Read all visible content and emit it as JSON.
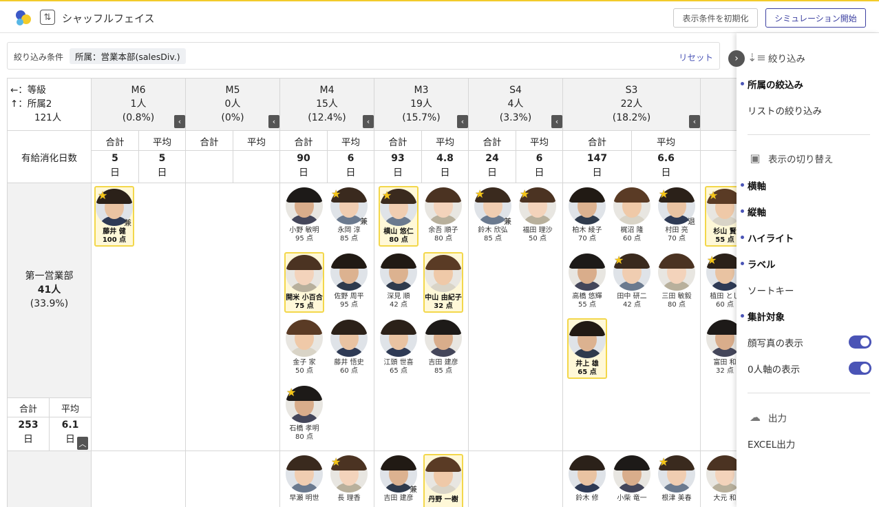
{
  "app": {
    "title": "シャッフルフェイス",
    "reset_view_label": "表示条件を初期化",
    "simulate_label": "シミュレーション開始"
  },
  "filter": {
    "label": "絞り込み条件",
    "chip": "所属：営業本部(salesDiv.)",
    "reset": "リセット"
  },
  "corner": {
    "x_axis": "←：等級",
    "y_axis": "↑：所属2",
    "total": "121人"
  },
  "metric": {
    "label": "有給消化日数",
    "sum_label": "合計",
    "avg_label": "平均"
  },
  "grades": [
    {
      "name": "M6",
      "count": "1人",
      "pct": "(0.8%)",
      "sum": "5",
      "avg": "5",
      "unit": "日"
    },
    {
      "name": "M5",
      "count": "0人",
      "pct": "(0%)",
      "sum": "",
      "avg": "",
      "unit": ""
    },
    {
      "name": "M4",
      "count": "15人",
      "pct": "(12.4%)",
      "sum": "90",
      "avg": "6",
      "unit": "日"
    },
    {
      "name": "M3",
      "count": "19人",
      "pct": "(15.7%)",
      "sum": "93",
      "avg": "4.8",
      "unit": "日"
    },
    {
      "name": "S4",
      "count": "4人",
      "pct": "(3.3%)",
      "sum": "24",
      "avg": "6",
      "unit": "日"
    },
    {
      "name": "S3",
      "count": "22人",
      "pct": "(18.2%)",
      "sum": "147",
      "avg": "6.6",
      "unit": "日"
    }
  ],
  "row1": {
    "name": "第一営業部",
    "count": "41人",
    "pct": "(33.9%)",
    "sum": "253",
    "avg": "6.1",
    "unit": "日"
  },
  "people": [
    {
      "name": "藤井 健",
      "score": "100 点",
      "star": true,
      "tag": "兼",
      "hl": true
    },
    {
      "name": "小野 敏明",
      "score": "95 点",
      "star": false,
      "tag": "",
      "hl": false
    },
    {
      "name": "永岡 淳",
      "score": "85 点",
      "star": true,
      "tag": "兼",
      "hl": false
    },
    {
      "name": "開米 小百合",
      "score": "75 点",
      "star": false,
      "tag": "",
      "hl": true
    },
    {
      "name": "佐野 周平",
      "score": "95 点",
      "star": false,
      "tag": "",
      "hl": false
    },
    {
      "name": "金子 家",
      "score": "50 点",
      "star": false,
      "tag": "",
      "hl": false
    },
    {
      "name": "藤井 悟史",
      "score": "60 点",
      "star": false,
      "tag": "",
      "hl": false
    },
    {
      "name": "石橋 孝明",
      "score": "80 点",
      "star": true,
      "tag": "",
      "hl": false
    },
    {
      "name": "横山 悠仁",
      "score": "80 点",
      "star": true,
      "tag": "",
      "hl": true
    },
    {
      "name": "余吾 順子",
      "score": "80 点",
      "star": false,
      "tag": "",
      "hl": false
    },
    {
      "name": "深見 順",
      "score": "42 点",
      "star": false,
      "tag": "",
      "hl": false
    },
    {
      "name": "中山 由紀子",
      "score": "32 点",
      "star": false,
      "tag": "",
      "hl": true
    },
    {
      "name": "江頭 世喜",
      "score": "65 点",
      "star": false,
      "tag": "",
      "hl": false
    },
    {
      "name": "吉田 建彦",
      "score": "85 点",
      "star": false,
      "tag": "",
      "hl": false
    },
    {
      "name": "鈴木 欣弘",
      "score": "85 点",
      "star": true,
      "tag": "兼",
      "hl": false
    },
    {
      "name": "福田 理沙",
      "score": "50 点",
      "star": true,
      "tag": "",
      "hl": false
    },
    {
      "name": "柏木 綾子",
      "score": "70 点",
      "star": false,
      "tag": "",
      "hl": false
    },
    {
      "name": "梶沼 隆",
      "score": "60 点",
      "star": false,
      "tag": "",
      "hl": false
    },
    {
      "name": "村田 亮",
      "score": "70 点",
      "star": true,
      "tag": "退",
      "hl": false
    },
    {
      "name": "高橋 悠輝",
      "score": "55 点",
      "star": false,
      "tag": "",
      "hl": false
    },
    {
      "name": "田中 研二",
      "score": "42 点",
      "star": true,
      "tag": "",
      "hl": false
    },
    {
      "name": "三田 敏毅",
      "score": "80 点",
      "star": false,
      "tag": "",
      "hl": false
    },
    {
      "name": "井上 雄",
      "score": "65 点",
      "star": false,
      "tag": "",
      "hl": true
    },
    {
      "name": "杉山 賢",
      "score": "55 点",
      "star": true,
      "tag": "",
      "hl": true
    },
    {
      "name": "植田 とし",
      "score": "60 点",
      "star": true,
      "tag": "",
      "hl": false
    },
    {
      "name": "富田 和",
      "score": "32 点",
      "star": false,
      "tag": "",
      "hl": false
    },
    {
      "name": "早瀬 明世",
      "score": "",
      "star": false,
      "tag": "",
      "hl": false
    },
    {
      "name": "長 理香",
      "score": "",
      "star": true,
      "tag": "",
      "hl": false
    },
    {
      "name": "吉田 建彦",
      "score": "",
      "star": false,
      "tag": "兼",
      "hl": false
    },
    {
      "name": "丹野 一樹",
      "score": "",
      "star": false,
      "tag": "",
      "hl": true
    },
    {
      "name": "鈴木 修",
      "score": "",
      "star": false,
      "tag": "",
      "hl": false
    },
    {
      "name": "小柴 竜一",
      "score": "",
      "star": false,
      "tag": "",
      "hl": false
    },
    {
      "name": "根津 美春",
      "score": "",
      "star": true,
      "tag": "",
      "hl": false
    },
    {
      "name": "大元 和",
      "score": "",
      "star": false,
      "tag": "",
      "hl": false
    }
  ],
  "panel": {
    "filter_head": "絞り込み",
    "filter_items": [
      "所属の絞込み",
      "リストの絞り込み"
    ],
    "view_head": "表示の切り替え",
    "view_items": [
      "横軸",
      "縦軸",
      "ハイライト",
      "ラベル",
      "ソートキー",
      "集計対象"
    ],
    "toggles": [
      "顔写真の表示",
      "0人軸の表示"
    ],
    "output_head": "出力",
    "output_items": [
      "EXCEL出力"
    ]
  }
}
